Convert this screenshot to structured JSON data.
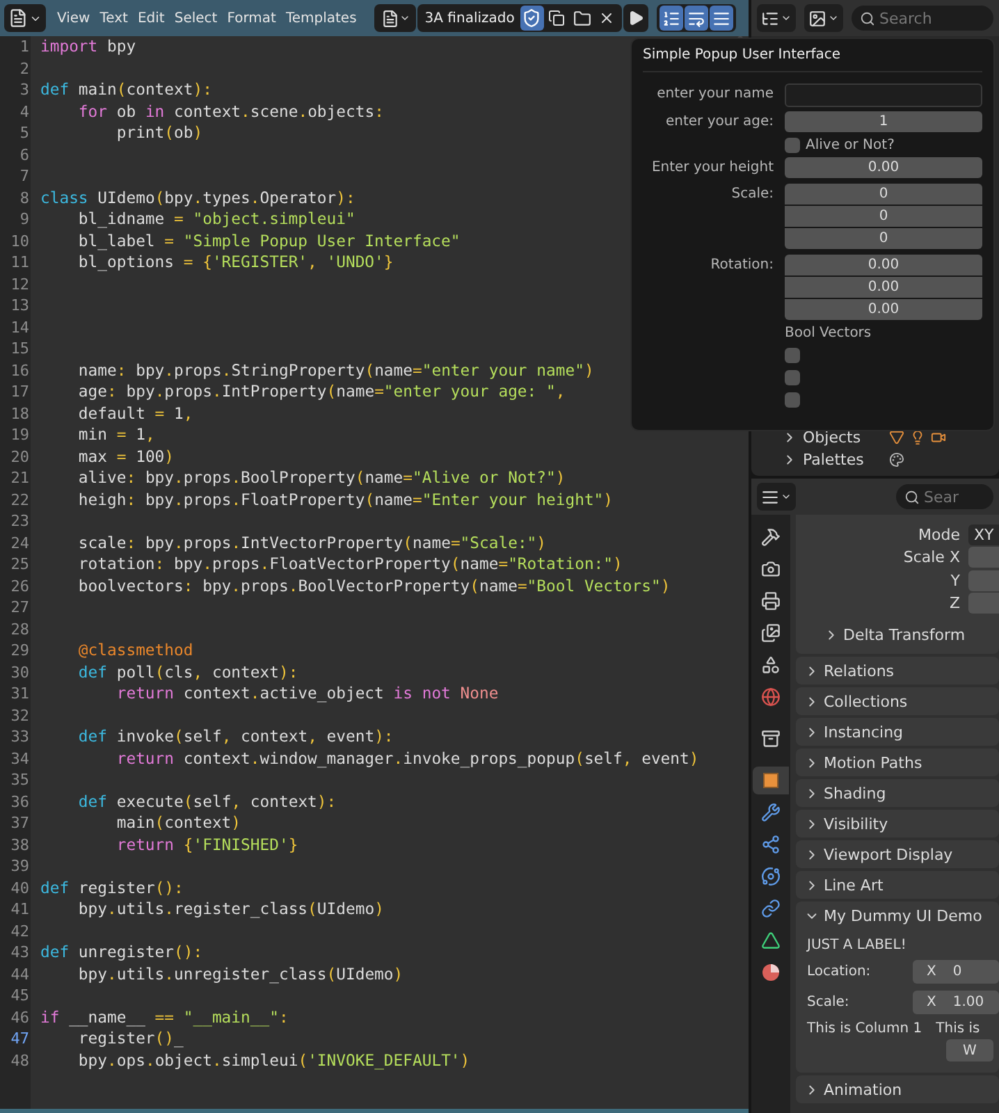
{
  "header": {
    "menus": [
      "View",
      "Text",
      "Edit",
      "Select",
      "Format",
      "Templates"
    ],
    "text_name": "3A finalizado",
    "fake_user": true,
    "toggles": [
      {
        "on": true
      },
      {
        "on": true
      },
      {
        "on": true
      }
    ]
  },
  "code": {
    "lines": [
      {
        "number": "1",
        "current": false,
        "tokens": [
          {
            "kind": "ctl",
            "text": "import"
          },
          {
            "kind": "plain",
            "text": " bpy"
          }
        ]
      },
      {
        "number": "2",
        "current": false
      },
      {
        "number": "3",
        "current": false,
        "tokens": [
          {
            "kind": "kw",
            "text": "def"
          },
          {
            "kind": "plain",
            "text": " main"
          },
          {
            "kind": "punct",
            "text": "("
          },
          {
            "kind": "plain",
            "text": "context"
          },
          {
            "kind": "punct",
            "text": "):"
          }
        ]
      },
      {
        "number": "4",
        "current": false,
        "tokens": [
          {
            "kind": "ctl",
            "text": "    for"
          },
          {
            "kind": "plain",
            "text": " ob "
          },
          {
            "kind": "ctl",
            "text": "in"
          },
          {
            "kind": "plain",
            "text": " context"
          },
          {
            "kind": "punct",
            "text": "."
          },
          {
            "kind": "plain",
            "text": "scene"
          },
          {
            "kind": "punct",
            "text": "."
          },
          {
            "kind": "plain",
            "text": "objects"
          },
          {
            "kind": "punct",
            "text": ":"
          }
        ]
      },
      {
        "number": "5",
        "current": false,
        "tokens": [
          {
            "kind": "plain",
            "text": "        print"
          },
          {
            "kind": "punct",
            "text": "("
          },
          {
            "kind": "plain",
            "text": "ob"
          },
          {
            "kind": "punct",
            "text": ")"
          }
        ]
      },
      {
        "number": "6",
        "current": false
      },
      {
        "number": "7",
        "current": false
      },
      {
        "number": "8",
        "current": false,
        "tokens": [
          {
            "kind": "kw",
            "text": "class"
          },
          {
            "kind": "plain",
            "text": " UIdemo"
          },
          {
            "kind": "punct",
            "text": "("
          },
          {
            "kind": "plain",
            "text": "bpy"
          },
          {
            "kind": "punct",
            "text": "."
          },
          {
            "kind": "plain",
            "text": "types"
          },
          {
            "kind": "punct",
            "text": "."
          },
          {
            "kind": "plain",
            "text": "Operator"
          },
          {
            "kind": "punct",
            "text": "):"
          }
        ]
      },
      {
        "number": "9",
        "current": false,
        "tokens": [
          {
            "kind": "plain",
            "text": "    bl_idname "
          },
          {
            "kind": "punct",
            "text": "="
          },
          {
            "kind": "str",
            "text": " \"object.simpleui\""
          }
        ]
      },
      {
        "number": "10",
        "current": false,
        "tokens": [
          {
            "kind": "plain",
            "text": "    bl_label "
          },
          {
            "kind": "punct",
            "text": "="
          },
          {
            "kind": "str",
            "text": " \"Simple Popup User Interface\""
          }
        ]
      },
      {
        "number": "11",
        "current": false,
        "tokens": [
          {
            "kind": "plain",
            "text": "    bl_options "
          },
          {
            "kind": "punct",
            "text": "= {"
          },
          {
            "kind": "str",
            "text": "'REGISTER'"
          },
          {
            "kind": "punct",
            "text": ","
          },
          {
            "kind": "str",
            "text": " 'UNDO'"
          },
          {
            "kind": "punct",
            "text": "}"
          }
        ]
      },
      {
        "number": "12",
        "current": false
      },
      {
        "number": "13",
        "current": false
      },
      {
        "number": "14",
        "current": false
      },
      {
        "number": "15",
        "current": false
      },
      {
        "number": "16",
        "current": false,
        "tokens": [
          {
            "kind": "plain",
            "text": "    name"
          },
          {
            "kind": "punct",
            "text": ":"
          },
          {
            "kind": "plain",
            "text": " bpy"
          },
          {
            "kind": "punct",
            "text": "."
          },
          {
            "kind": "plain",
            "text": "props"
          },
          {
            "kind": "punct",
            "text": "."
          },
          {
            "kind": "plain",
            "text": "StringProperty"
          },
          {
            "kind": "punct",
            "text": "("
          },
          {
            "kind": "plain",
            "text": "name"
          },
          {
            "kind": "punct",
            "text": "="
          },
          {
            "kind": "str",
            "text": "\"enter your name\""
          },
          {
            "kind": "punct",
            "text": ")"
          }
        ]
      },
      {
        "number": "17",
        "current": false,
        "tokens": [
          {
            "kind": "plain",
            "text": "    age"
          },
          {
            "kind": "punct",
            "text": ":"
          },
          {
            "kind": "plain",
            "text": " bpy"
          },
          {
            "kind": "punct",
            "text": "."
          },
          {
            "kind": "plain",
            "text": "props"
          },
          {
            "kind": "punct",
            "text": "."
          },
          {
            "kind": "plain",
            "text": "IntProperty"
          },
          {
            "kind": "punct",
            "text": "("
          },
          {
            "kind": "plain",
            "text": "name"
          },
          {
            "kind": "punct",
            "text": "="
          },
          {
            "kind": "str",
            "text": "\"enter your age: \""
          },
          {
            "kind": "punct",
            "text": ","
          }
        ]
      },
      {
        "number": "18",
        "current": false,
        "tokens": [
          {
            "kind": "plain",
            "text": "    default "
          },
          {
            "kind": "punct",
            "text": "="
          },
          {
            "kind": "plain",
            "text": " 1"
          },
          {
            "kind": "punct",
            "text": ","
          }
        ]
      },
      {
        "number": "19",
        "current": false,
        "tokens": [
          {
            "kind": "plain",
            "text": "    min "
          },
          {
            "kind": "punct",
            "text": "="
          },
          {
            "kind": "plain",
            "text": " 1"
          },
          {
            "kind": "punct",
            "text": ","
          }
        ]
      },
      {
        "number": "20",
        "current": false,
        "tokens": [
          {
            "kind": "plain",
            "text": "    max "
          },
          {
            "kind": "punct",
            "text": "="
          },
          {
            "kind": "plain",
            "text": " 100"
          },
          {
            "kind": "punct",
            "text": ")"
          }
        ]
      },
      {
        "number": "21",
        "current": false,
        "tokens": [
          {
            "kind": "plain",
            "text": "    alive"
          },
          {
            "kind": "punct",
            "text": ":"
          },
          {
            "kind": "plain",
            "text": " bpy"
          },
          {
            "kind": "punct",
            "text": "."
          },
          {
            "kind": "plain",
            "text": "props"
          },
          {
            "kind": "punct",
            "text": "."
          },
          {
            "kind": "plain",
            "text": "BoolProperty"
          },
          {
            "kind": "punct",
            "text": "("
          },
          {
            "kind": "plain",
            "text": "name"
          },
          {
            "kind": "punct",
            "text": "="
          },
          {
            "kind": "str",
            "text": "\"Alive or Not?\""
          },
          {
            "kind": "punct",
            "text": ")"
          }
        ]
      },
      {
        "number": "22",
        "current": false,
        "tokens": [
          {
            "kind": "plain",
            "text": "    heigh"
          },
          {
            "kind": "punct",
            "text": ":"
          },
          {
            "kind": "plain",
            "text": " bpy"
          },
          {
            "kind": "punct",
            "text": "."
          },
          {
            "kind": "plain",
            "text": "props"
          },
          {
            "kind": "punct",
            "text": "."
          },
          {
            "kind": "plain",
            "text": "FloatProperty"
          },
          {
            "kind": "punct",
            "text": "("
          },
          {
            "kind": "plain",
            "text": "name"
          },
          {
            "kind": "punct",
            "text": "="
          },
          {
            "kind": "str",
            "text": "\"Enter your height\""
          },
          {
            "kind": "punct",
            "text": ")"
          }
        ]
      },
      {
        "number": "23",
        "current": false
      },
      {
        "number": "24",
        "current": false,
        "tokens": [
          {
            "kind": "plain",
            "text": "    scale"
          },
          {
            "kind": "punct",
            "text": ":"
          },
          {
            "kind": "plain",
            "text": " bpy"
          },
          {
            "kind": "punct",
            "text": "."
          },
          {
            "kind": "plain",
            "text": "props"
          },
          {
            "kind": "punct",
            "text": "."
          },
          {
            "kind": "plain",
            "text": "IntVectorProperty"
          },
          {
            "kind": "punct",
            "text": "("
          },
          {
            "kind": "plain",
            "text": "name"
          },
          {
            "kind": "punct",
            "text": "="
          },
          {
            "kind": "str",
            "text": "\"Scale:\""
          },
          {
            "kind": "punct",
            "text": ")"
          }
        ]
      },
      {
        "number": "25",
        "current": false,
        "tokens": [
          {
            "kind": "plain",
            "text": "    rotation"
          },
          {
            "kind": "punct",
            "text": ":"
          },
          {
            "kind": "plain",
            "text": " bpy"
          },
          {
            "kind": "punct",
            "text": "."
          },
          {
            "kind": "plain",
            "text": "props"
          },
          {
            "kind": "punct",
            "text": "."
          },
          {
            "kind": "plain",
            "text": "FloatVectorProperty"
          },
          {
            "kind": "punct",
            "text": "("
          },
          {
            "kind": "plain",
            "text": "name"
          },
          {
            "kind": "punct",
            "text": "="
          },
          {
            "kind": "str",
            "text": "\"Rotation:\""
          },
          {
            "kind": "punct",
            "text": ")"
          }
        ]
      },
      {
        "number": "26",
        "current": false,
        "tokens": [
          {
            "kind": "plain",
            "text": "    boolvectors"
          },
          {
            "kind": "punct",
            "text": ":"
          },
          {
            "kind": "plain",
            "text": " bpy"
          },
          {
            "kind": "punct",
            "text": "."
          },
          {
            "kind": "plain",
            "text": "props"
          },
          {
            "kind": "punct",
            "text": "."
          },
          {
            "kind": "plain",
            "text": "BoolVectorProperty"
          },
          {
            "kind": "punct",
            "text": "("
          },
          {
            "kind": "plain",
            "text": "name"
          },
          {
            "kind": "punct",
            "text": "="
          },
          {
            "kind": "str",
            "text": "\"Bool Vectors\""
          },
          {
            "kind": "punct",
            "text": ")"
          }
        ]
      },
      {
        "number": "27",
        "current": false
      },
      {
        "number": "28",
        "current": false
      },
      {
        "number": "29",
        "current": false,
        "tokens": [
          {
            "kind": "deco",
            "text": "    @classmethod"
          }
        ]
      },
      {
        "number": "30",
        "current": false,
        "tokens": [
          {
            "kind": "kw",
            "text": "    def"
          },
          {
            "kind": "plain",
            "text": " poll"
          },
          {
            "kind": "punct",
            "text": "("
          },
          {
            "kind": "plain",
            "text": "cls"
          },
          {
            "kind": "punct",
            "text": ","
          },
          {
            "kind": "plain",
            "text": " context"
          },
          {
            "kind": "punct",
            "text": "):"
          }
        ]
      },
      {
        "number": "31",
        "current": false,
        "tokens": [
          {
            "kind": "ctl",
            "text": "        return"
          },
          {
            "kind": "plain",
            "text": " context"
          },
          {
            "kind": "punct",
            "text": "."
          },
          {
            "kind": "plain",
            "text": "active_object "
          },
          {
            "kind": "ctl",
            "text": "is not"
          },
          {
            "kind": "const",
            "text": " None"
          }
        ]
      },
      {
        "number": "32",
        "current": false
      },
      {
        "number": "33",
        "current": false,
        "tokens": [
          {
            "kind": "kw",
            "text": "    def"
          },
          {
            "kind": "plain",
            "text": " invoke"
          },
          {
            "kind": "punct",
            "text": "("
          },
          {
            "kind": "plain",
            "text": "self"
          },
          {
            "kind": "punct",
            "text": ","
          },
          {
            "kind": "plain",
            "text": " context"
          },
          {
            "kind": "punct",
            "text": ","
          },
          {
            "kind": "plain",
            "text": " event"
          },
          {
            "kind": "punct",
            "text": "):"
          }
        ]
      },
      {
        "number": "34",
        "current": false,
        "tokens": [
          {
            "kind": "ctl",
            "text": "        return"
          },
          {
            "kind": "plain",
            "text": " context"
          },
          {
            "kind": "punct",
            "text": "."
          },
          {
            "kind": "plain",
            "text": "window_manager"
          },
          {
            "kind": "punct",
            "text": "."
          },
          {
            "kind": "plain",
            "text": "invoke_props_popup"
          },
          {
            "kind": "punct",
            "text": "("
          },
          {
            "kind": "plain",
            "text": "self"
          },
          {
            "kind": "punct",
            "text": ","
          },
          {
            "kind": "plain",
            "text": " event"
          },
          {
            "kind": "punct",
            "text": ")"
          }
        ]
      },
      {
        "number": "35",
        "current": false
      },
      {
        "number": "36",
        "current": false,
        "tokens": [
          {
            "kind": "kw",
            "text": "    def"
          },
          {
            "kind": "plain",
            "text": " execute"
          },
          {
            "kind": "punct",
            "text": "("
          },
          {
            "kind": "plain",
            "text": "self"
          },
          {
            "kind": "punct",
            "text": ","
          },
          {
            "kind": "plain",
            "text": " context"
          },
          {
            "kind": "punct",
            "text": "):"
          }
        ]
      },
      {
        "number": "37",
        "current": false,
        "tokens": [
          {
            "kind": "plain",
            "text": "        main"
          },
          {
            "kind": "punct",
            "text": "("
          },
          {
            "kind": "plain",
            "text": "context"
          },
          {
            "kind": "punct",
            "text": ")"
          }
        ]
      },
      {
        "number": "38",
        "current": false,
        "tokens": [
          {
            "kind": "ctl",
            "text": "        return"
          },
          {
            "kind": "punct",
            "text": " {"
          },
          {
            "kind": "str",
            "text": "'FINISHED'"
          },
          {
            "kind": "punct",
            "text": "}"
          }
        ]
      },
      {
        "number": "39",
        "current": false
      },
      {
        "number": "40",
        "current": false,
        "tokens": [
          {
            "kind": "kw",
            "text": "def"
          },
          {
            "kind": "plain",
            "text": " register"
          },
          {
            "kind": "punct",
            "text": "():"
          }
        ]
      },
      {
        "number": "41",
        "current": false,
        "tokens": [
          {
            "kind": "plain",
            "text": "    bpy"
          },
          {
            "kind": "punct",
            "text": "."
          },
          {
            "kind": "plain",
            "text": "utils"
          },
          {
            "kind": "punct",
            "text": "."
          },
          {
            "kind": "plain",
            "text": "register_class"
          },
          {
            "kind": "punct",
            "text": "("
          },
          {
            "kind": "plain",
            "text": "UIdemo"
          },
          {
            "kind": "punct",
            "text": ")"
          }
        ]
      },
      {
        "number": "42",
        "current": false
      },
      {
        "number": "43",
        "current": false,
        "tokens": [
          {
            "kind": "kw",
            "text": "def"
          },
          {
            "kind": "plain",
            "text": " unregister"
          },
          {
            "kind": "punct",
            "text": "():"
          }
        ]
      },
      {
        "number": "44",
        "current": false,
        "tokens": [
          {
            "kind": "plain",
            "text": "    bpy"
          },
          {
            "kind": "punct",
            "text": "."
          },
          {
            "kind": "plain",
            "text": "utils"
          },
          {
            "kind": "punct",
            "text": "."
          },
          {
            "kind": "plain",
            "text": "unregister_class"
          },
          {
            "kind": "punct",
            "text": "("
          },
          {
            "kind": "plain",
            "text": "UIdemo"
          },
          {
            "kind": "punct",
            "text": ")"
          }
        ]
      },
      {
        "number": "45",
        "current": false
      },
      {
        "number": "46",
        "current": false,
        "tokens": [
          {
            "kind": "ctl",
            "text": "if"
          },
          {
            "kind": "plain",
            "text": " __name__ "
          },
          {
            "kind": "punct",
            "text": "=="
          },
          {
            "kind": "str",
            "text": " \"__main__\""
          },
          {
            "kind": "punct",
            "text": ":"
          }
        ]
      },
      {
        "number": "47",
        "current": true,
        "tokens": [
          {
            "kind": "plain",
            "text": "    register"
          },
          {
            "kind": "punct",
            "text": "()"
          },
          {
            "kind": "plain",
            "text": "_"
          }
        ]
      },
      {
        "number": "48",
        "current": false,
        "tokens": [
          {
            "kind": "plain",
            "text": "    bpy"
          },
          {
            "kind": "punct",
            "text": "."
          },
          {
            "kind": "plain",
            "text": "ops"
          },
          {
            "kind": "punct",
            "text": "."
          },
          {
            "kind": "plain",
            "text": "object"
          },
          {
            "kind": "punct",
            "text": "."
          },
          {
            "kind": "plain",
            "text": "simpleui"
          },
          {
            "kind": "punct",
            "text": "("
          },
          {
            "kind": "str",
            "text": "'INVOKE_DEFAULT'"
          },
          {
            "kind": "punct",
            "text": ")"
          }
        ]
      }
    ]
  },
  "outliner": {
    "search_placeholder": "Search",
    "rows": [
      {
        "label": "Objects",
        "expanded": false
      },
      {
        "label": "Palettes",
        "expanded": false
      }
    ]
  },
  "properties": {
    "search_placeholder": "Sear",
    "tabs": [
      {
        "selected": false
      },
      {
        "selected": false
      },
      {
        "selected": false
      },
      {
        "selected": false
      },
      {
        "selected": false
      },
      {
        "selected": false
      },
      {
        "selected": false
      },
      {
        "selected": true
      },
      {
        "selected": false
      },
      {
        "selected": false
      },
      {
        "selected": false
      },
      {
        "selected": false
      },
      {
        "selected": false
      },
      {
        "selected": false
      }
    ],
    "transform": {
      "rows": [
        {
          "label": "Mode",
          "value": "XY"
        },
        {
          "label": "Scale X"
        },
        {
          "label": "Y"
        },
        {
          "label": "Z"
        }
      ],
      "subpanels": [
        {
          "title": "Delta Transform",
          "expanded": false
        }
      ]
    },
    "panels": [
      {
        "title": "Relations",
        "expanded": false
      },
      {
        "title": "Collections",
        "expanded": false
      },
      {
        "title": "Instancing",
        "expanded": false
      },
      {
        "title": "Motion Paths",
        "expanded": false
      },
      {
        "title": "Shading",
        "expanded": false
      },
      {
        "title": "Visibility",
        "expanded": false
      },
      {
        "title": "Viewport Display",
        "expanded": false
      },
      {
        "title": "Line Art",
        "expanded": false
      },
      {
        "title": "My Dummy UI Demo",
        "expanded": true,
        "content": {
          "label": "JUST A LABEL!",
          "props": [
            {
              "label": "Location:",
              "axis": "X",
              "value": "0"
            },
            {
              "label": "Scale:",
              "axis": "X",
              "value": "1.00"
            }
          ],
          "columns": [
            "This is Column 1",
            "This is"
          ],
          "button": "W"
        }
      },
      {
        "title": "Animation",
        "expanded": false
      }
    ]
  },
  "popup": {
    "title": "Simple Popup User Interface",
    "rows": [
      {
        "kind": "text",
        "label": "enter your name"
      },
      {
        "kind": "number",
        "label": "enter your age:",
        "value": "1"
      },
      {
        "kind": "checkbox",
        "label": "Alive or Not?",
        "checked": false
      },
      {
        "kind": "number",
        "label": "Enter your height",
        "value": "0.00"
      },
      {
        "kind": "vector",
        "label": "Scale:",
        "values": [
          "0",
          "0",
          "0"
        ]
      },
      {
        "kind": "vector",
        "label": "Rotation:",
        "values": [
          "0.00",
          "0.00",
          "0.00"
        ]
      },
      {
        "kind": "bool_vector",
        "label": "Bool Vectors",
        "items": [
          {
            "checked": false
          },
          {
            "checked": false
          },
          {
            "checked": false
          }
        ]
      }
    ]
  }
}
